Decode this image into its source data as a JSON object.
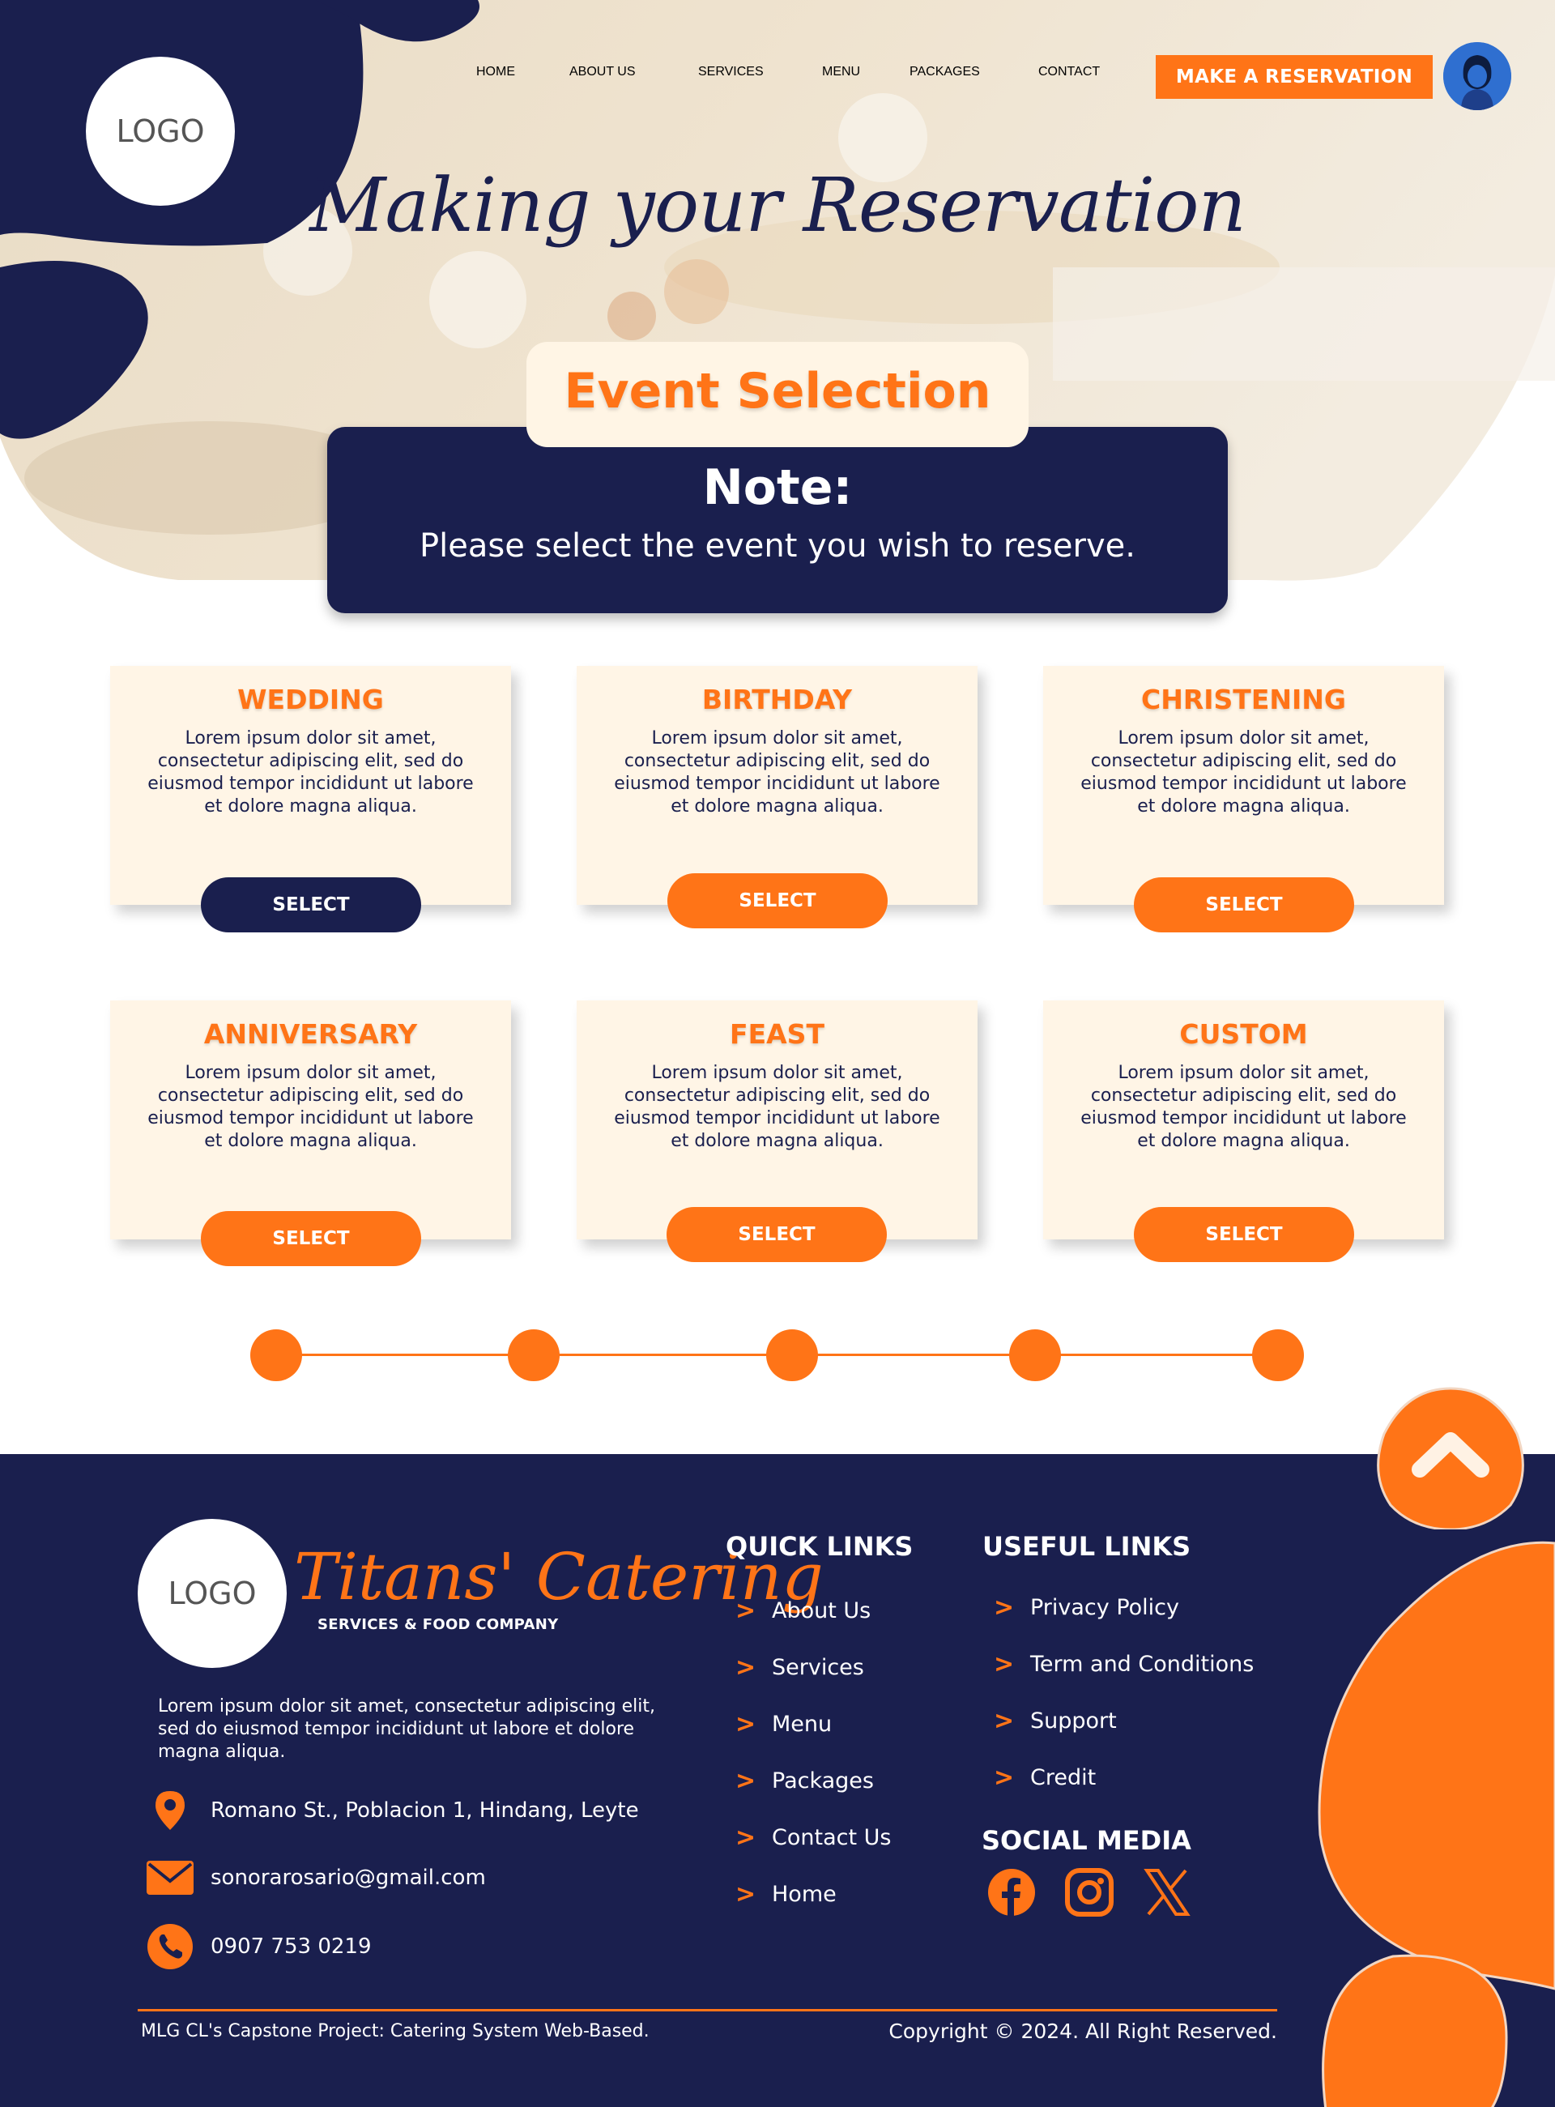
{
  "header": {
    "logo_text": "LOGO",
    "nav": [
      "HOME",
      "ABOUT US",
      "SERVICES",
      "MENU",
      "PACKAGES",
      "CONTACT"
    ],
    "reserve_label": "MAKE A RESERVATION"
  },
  "hero": {
    "title": "Making your Reservation",
    "section_label": "Event Selection",
    "note_title": "Note:",
    "note_text": "Please select the event you wish to reserve."
  },
  "events": [
    {
      "title": "WEDDING",
      "text": "Lorem ipsum dolor sit amet, consectetur adipiscing elit, sed do eiusmod tempor incididunt ut labore et dolore magna aliqua.",
      "button": "SELECT",
      "selected": true
    },
    {
      "title": "BIRTHDAY",
      "text": "Lorem ipsum dolor sit amet, consectetur adipiscing elit, sed do eiusmod tempor incididunt ut labore et dolore magna aliqua.",
      "button": "SELECT",
      "selected": false
    },
    {
      "title": "CHRISTENING",
      "text": "Lorem ipsum dolor sit amet, consectetur adipiscing elit, sed do eiusmod tempor incididunt ut labore et dolore magna aliqua.",
      "button": "SELECT",
      "selected": false
    },
    {
      "title": "ANNIVERSARY",
      "text": "Lorem ipsum dolor sit amet, consectetur adipiscing elit, sed do eiusmod tempor incididunt ut labore et dolore magna aliqua.",
      "button": "SELECT",
      "selected": false
    },
    {
      "title": "FEAST",
      "text": "Lorem ipsum dolor sit amet, consectetur adipiscing elit, sed do eiusmod tempor incididunt ut labore et dolore magna aliqua.",
      "button": "SELECT",
      "selected": false
    },
    {
      "title": "CUSTOM",
      "text": "Lorem ipsum dolor sit amet, consectetur adipiscing elit, sed do eiusmod tempor incididunt ut labore et dolore magna aliqua.",
      "button": "SELECT",
      "selected": false
    }
  ],
  "stepper": {
    "steps": 5
  },
  "footer": {
    "logo_text": "LOGO",
    "brand_name": "Titans' Catering",
    "brand_tagline": "SERVICES & FOOD COMPANY",
    "description": "Lorem ipsum dolor sit amet, consectetur adipiscing elit, sed do eiusmod tempor incididunt ut labore et dolore magna aliqua.",
    "address": "Romano St., Poblacion 1, Hindang, Leyte",
    "email": "sonorarosario@gmail.com",
    "phone": "0907 753 0219",
    "quick_links_title": "QUICK LINKS",
    "quick_links": [
      "About Us",
      "Services",
      "Menu",
      "Packages",
      "Contact Us",
      "Home"
    ],
    "useful_links_title": "USEFUL LINKS",
    "useful_links": [
      "Privacy Policy",
      "Term and Conditions",
      "Support",
      "Credit"
    ],
    "social_title": "SOCIAL MEDIA",
    "social_icons": [
      "facebook-icon",
      "instagram-icon",
      "x-icon"
    ],
    "project_note": "MLG CL's Capstone Project: Catering System Web-Based.",
    "copyright": "Copyright © 2024. All Right Reserved."
  },
  "colors": {
    "navy": "#1a1f4e",
    "orange": "#ff7417",
    "cream": "#fff5e6"
  }
}
